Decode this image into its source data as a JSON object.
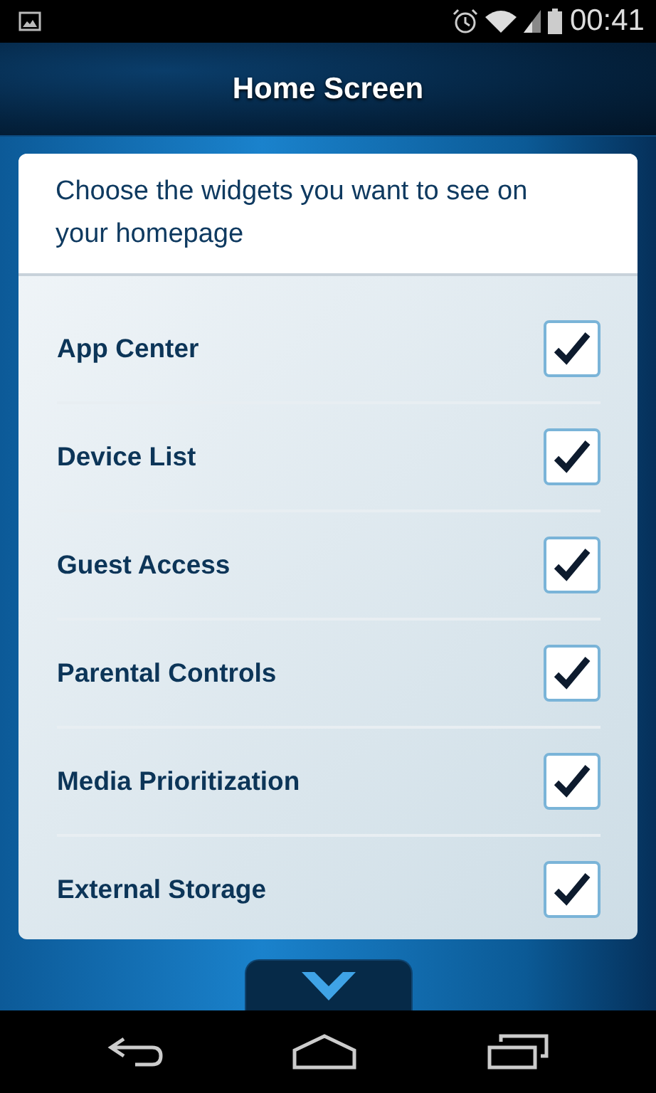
{
  "status_bar": {
    "time": "00:41"
  },
  "header": {
    "title": "Home Screen"
  },
  "intro": "Choose the widgets you want to see on your homepage",
  "widgets": [
    {
      "label": "App Center",
      "checked": true
    },
    {
      "label": "Device List",
      "checked": true
    },
    {
      "label": "Guest Access",
      "checked": true
    },
    {
      "label": "Parental Controls",
      "checked": true
    },
    {
      "label": "Media Prioritization",
      "checked": true
    },
    {
      "label": "External Storage",
      "checked": true
    }
  ]
}
